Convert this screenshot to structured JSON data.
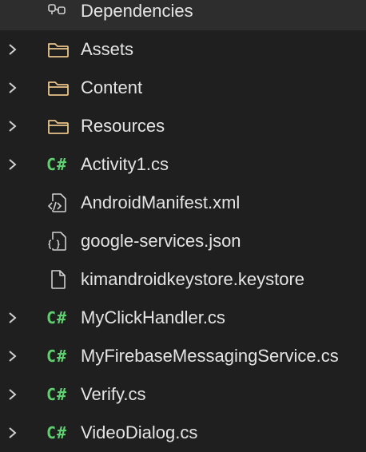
{
  "solution_explorer": {
    "items": [
      {
        "label": "Dependencies",
        "icon": "dependencies-icon",
        "expandable": false,
        "selected": true
      },
      {
        "label": "Assets",
        "icon": "folder-icon",
        "expandable": true
      },
      {
        "label": "Content",
        "icon": "folder-icon",
        "expandable": true
      },
      {
        "label": "Resources",
        "icon": "folder-icon",
        "expandable": true
      },
      {
        "label": "Activity1.cs",
        "icon": "csharp-file-icon",
        "icon_text": "C#",
        "expandable": true
      },
      {
        "label": "AndroidManifest.xml",
        "icon": "xml-file-icon",
        "expandable": false
      },
      {
        "label": "google-services.json",
        "icon": "json-file-icon",
        "expandable": false
      },
      {
        "label": "kimandroidkeystore.keystore",
        "icon": "file-icon",
        "expandable": false
      },
      {
        "label": "MyClickHandler.cs",
        "icon": "csharp-file-icon",
        "icon_text": "C#",
        "expandable": true
      },
      {
        "label": "MyFirebaseMessagingService.cs",
        "icon": "csharp-file-icon",
        "icon_text": "C#",
        "expandable": true
      },
      {
        "label": "Verify.cs",
        "icon": "csharp-file-icon",
        "icon_text": "C#",
        "expandable": true
      },
      {
        "label": "VideoDialog.cs",
        "icon": "csharp-file-icon",
        "icon_text": "C#",
        "expandable": true
      }
    ]
  },
  "colors": {
    "background": "#1f1f1f",
    "selected_row": "#2d2d2d",
    "text": "#e4e4e4",
    "folder": "#e8c48a",
    "csharp": "#5fcf6f",
    "icon_stroke": "#d0d0d0"
  }
}
